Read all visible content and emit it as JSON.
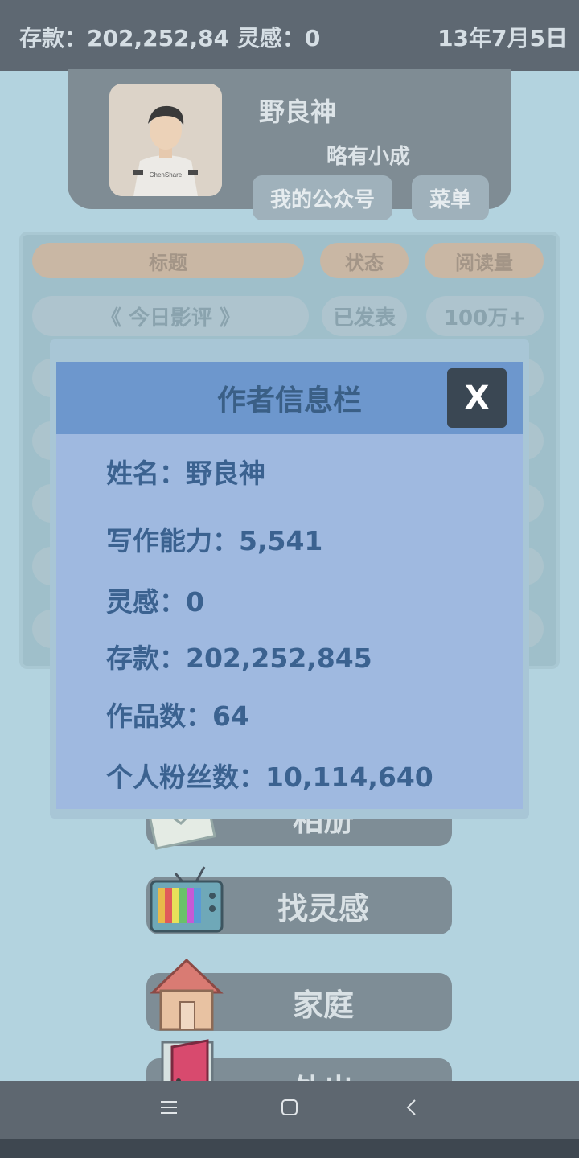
{
  "status": {
    "money_label": "存款：202,252,84 灵感：0",
    "date": "13年7月5日"
  },
  "profile": {
    "name": "野良神",
    "rank": "略有小成",
    "btn_official": "我的公众号",
    "btn_menu": "菜单"
  },
  "table": {
    "headers": [
      "标题",
      "状态",
      "阅读量"
    ],
    "row": {
      "title": "《 今日影评 》",
      "status": "已发表",
      "reads": "100万+"
    }
  },
  "menu": {
    "album_label": "相册",
    "inspiration_label": "找灵感",
    "family_label": "家庭",
    "outing_label": "外出"
  },
  "modal": {
    "title": "作者信息栏",
    "close": "X",
    "name_line": "姓名：野良神",
    "ability_line": "写作能力：5,541",
    "inspiration_line": "灵感：0",
    "savings_line": "存款：202,252,845",
    "works_line": "作品数：64",
    "fans_line": "个人粉丝数：10,114,640"
  },
  "icons": [
    "menu-icon",
    "home-icon",
    "back-icon",
    "envelope-icon",
    "tv-icon",
    "house-icon",
    "door-icon",
    "close-icon"
  ],
  "colors": {
    "modal_bg": "#9fb9e0",
    "modal_header": "#6d97cd",
    "modal_text": "#3b6290",
    "close_bg": "#3a4753"
  }
}
